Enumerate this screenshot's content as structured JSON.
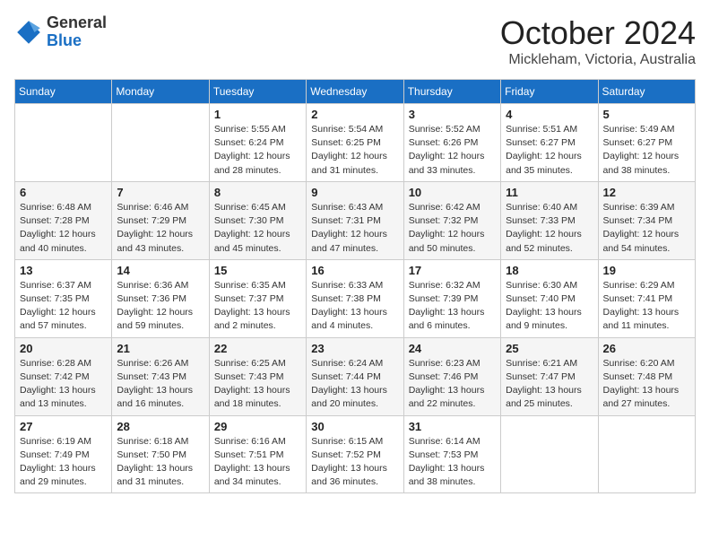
{
  "header": {
    "logo_general": "General",
    "logo_blue": "Blue",
    "month": "October 2024",
    "location": "Mickleham, Victoria, Australia"
  },
  "days_of_week": [
    "Sunday",
    "Monday",
    "Tuesday",
    "Wednesday",
    "Thursday",
    "Friday",
    "Saturday"
  ],
  "weeks": [
    [
      {
        "day": "",
        "info": ""
      },
      {
        "day": "",
        "info": ""
      },
      {
        "day": "1",
        "info": "Sunrise: 5:55 AM\nSunset: 6:24 PM\nDaylight: 12 hours and 28 minutes."
      },
      {
        "day": "2",
        "info": "Sunrise: 5:54 AM\nSunset: 6:25 PM\nDaylight: 12 hours and 31 minutes."
      },
      {
        "day": "3",
        "info": "Sunrise: 5:52 AM\nSunset: 6:26 PM\nDaylight: 12 hours and 33 minutes."
      },
      {
        "day": "4",
        "info": "Sunrise: 5:51 AM\nSunset: 6:27 PM\nDaylight: 12 hours and 35 minutes."
      },
      {
        "day": "5",
        "info": "Sunrise: 5:49 AM\nSunset: 6:27 PM\nDaylight: 12 hours and 38 minutes."
      }
    ],
    [
      {
        "day": "6",
        "info": "Sunrise: 6:48 AM\nSunset: 7:28 PM\nDaylight: 12 hours and 40 minutes."
      },
      {
        "day": "7",
        "info": "Sunrise: 6:46 AM\nSunset: 7:29 PM\nDaylight: 12 hours and 43 minutes."
      },
      {
        "day": "8",
        "info": "Sunrise: 6:45 AM\nSunset: 7:30 PM\nDaylight: 12 hours and 45 minutes."
      },
      {
        "day": "9",
        "info": "Sunrise: 6:43 AM\nSunset: 7:31 PM\nDaylight: 12 hours and 47 minutes."
      },
      {
        "day": "10",
        "info": "Sunrise: 6:42 AM\nSunset: 7:32 PM\nDaylight: 12 hours and 50 minutes."
      },
      {
        "day": "11",
        "info": "Sunrise: 6:40 AM\nSunset: 7:33 PM\nDaylight: 12 hours and 52 minutes."
      },
      {
        "day": "12",
        "info": "Sunrise: 6:39 AM\nSunset: 7:34 PM\nDaylight: 12 hours and 54 minutes."
      }
    ],
    [
      {
        "day": "13",
        "info": "Sunrise: 6:37 AM\nSunset: 7:35 PM\nDaylight: 12 hours and 57 minutes."
      },
      {
        "day": "14",
        "info": "Sunrise: 6:36 AM\nSunset: 7:36 PM\nDaylight: 12 hours and 59 minutes."
      },
      {
        "day": "15",
        "info": "Sunrise: 6:35 AM\nSunset: 7:37 PM\nDaylight: 13 hours and 2 minutes."
      },
      {
        "day": "16",
        "info": "Sunrise: 6:33 AM\nSunset: 7:38 PM\nDaylight: 13 hours and 4 minutes."
      },
      {
        "day": "17",
        "info": "Sunrise: 6:32 AM\nSunset: 7:39 PM\nDaylight: 13 hours and 6 minutes."
      },
      {
        "day": "18",
        "info": "Sunrise: 6:30 AM\nSunset: 7:40 PM\nDaylight: 13 hours and 9 minutes."
      },
      {
        "day": "19",
        "info": "Sunrise: 6:29 AM\nSunset: 7:41 PM\nDaylight: 13 hours and 11 minutes."
      }
    ],
    [
      {
        "day": "20",
        "info": "Sunrise: 6:28 AM\nSunset: 7:42 PM\nDaylight: 13 hours and 13 minutes."
      },
      {
        "day": "21",
        "info": "Sunrise: 6:26 AM\nSunset: 7:43 PM\nDaylight: 13 hours and 16 minutes."
      },
      {
        "day": "22",
        "info": "Sunrise: 6:25 AM\nSunset: 7:43 PM\nDaylight: 13 hours and 18 minutes."
      },
      {
        "day": "23",
        "info": "Sunrise: 6:24 AM\nSunset: 7:44 PM\nDaylight: 13 hours and 20 minutes."
      },
      {
        "day": "24",
        "info": "Sunrise: 6:23 AM\nSunset: 7:46 PM\nDaylight: 13 hours and 22 minutes."
      },
      {
        "day": "25",
        "info": "Sunrise: 6:21 AM\nSunset: 7:47 PM\nDaylight: 13 hours and 25 minutes."
      },
      {
        "day": "26",
        "info": "Sunrise: 6:20 AM\nSunset: 7:48 PM\nDaylight: 13 hours and 27 minutes."
      }
    ],
    [
      {
        "day": "27",
        "info": "Sunrise: 6:19 AM\nSunset: 7:49 PM\nDaylight: 13 hours and 29 minutes."
      },
      {
        "day": "28",
        "info": "Sunrise: 6:18 AM\nSunset: 7:50 PM\nDaylight: 13 hours and 31 minutes."
      },
      {
        "day": "29",
        "info": "Sunrise: 6:16 AM\nSunset: 7:51 PM\nDaylight: 13 hours and 34 minutes."
      },
      {
        "day": "30",
        "info": "Sunrise: 6:15 AM\nSunset: 7:52 PM\nDaylight: 13 hours and 36 minutes."
      },
      {
        "day": "31",
        "info": "Sunrise: 6:14 AM\nSunset: 7:53 PM\nDaylight: 13 hours and 38 minutes."
      },
      {
        "day": "",
        "info": ""
      },
      {
        "day": "",
        "info": ""
      }
    ]
  ]
}
